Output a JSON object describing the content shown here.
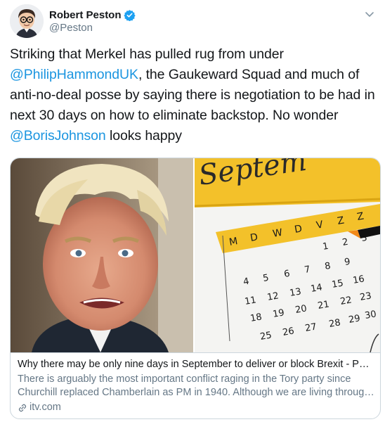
{
  "author": {
    "name": "Robert Peston",
    "handle": "@Peston",
    "verified": true,
    "avatar_icon": "cartoon-avatar"
  },
  "tweet": {
    "part1": "Striking that Merkel has pulled rug from under ",
    "mention1": "@PhilipHammondUK",
    "part2": ", the Gaukeward Squad and much of anti-no-deal posse by saying there is negotiation to be had in next 30 days on how to eliminate backstop. No wonder ",
    "mention2": "@BorisJohnson",
    "part3": " looks happy"
  },
  "card": {
    "title": "Why there may be only nine days in September to deliver or block Brexit - Pes...",
    "description_line1": "There is arguably the most important conflict raging in the Tory party since",
    "description_line2": "Churchill replaced Chamberlain as PM in 1940. Although we are living through...",
    "domain": "itv.com",
    "calendar": {
      "month_fragment": "Septem",
      "weekdays": [
        "M",
        "D",
        "W",
        "D",
        "V",
        "Z",
        "Z"
      ],
      "rows": [
        [
          "",
          "",
          "",
          "",
          "1",
          "2",
          "3"
        ],
        [
          "4",
          "5",
          "6",
          "7",
          "8",
          "9",
          ""
        ],
        [
          "11",
          "12",
          "13",
          "14",
          "15",
          "16",
          ""
        ],
        [
          "18",
          "19",
          "20",
          "21",
          "22",
          "23",
          ""
        ],
        [
          "25",
          "26",
          "27",
          "28",
          "29",
          "30",
          ""
        ]
      ]
    }
  },
  "colors": {
    "link": "#1b95e0",
    "text": "#14171a",
    "secondary": "#657786",
    "border": "#ccd6dd",
    "verified": "#1da1f2",
    "calendar_highlight": "#f3b71b"
  },
  "icons": [
    "verified-badge-icon",
    "chevron-down-icon",
    "link-icon"
  ]
}
